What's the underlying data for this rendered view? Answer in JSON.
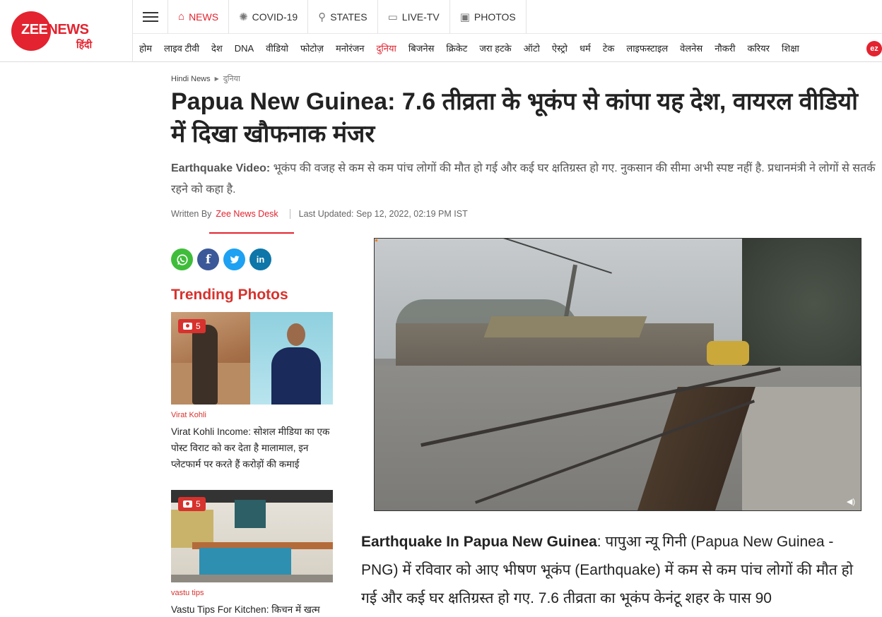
{
  "brand": {
    "logo_main_a": "ZEE",
    "logo_main_b": "NEWS",
    "logo_sub": "हिंदी",
    "accent_color": "#e3232f"
  },
  "topnav": {
    "menu_icon": "hamburger-icon",
    "items": [
      {
        "label": "NEWS",
        "icon": "home-icon",
        "active": true
      },
      {
        "label": "COVID-19",
        "icon": "virus-icon"
      },
      {
        "label": "STATES",
        "icon": "location-pin-icon"
      },
      {
        "label": "LIVE-TV",
        "icon": "tv-icon"
      },
      {
        "label": "PHOTOS",
        "icon": "image-icon"
      }
    ]
  },
  "categories": [
    "होम",
    "लाइव टीवी",
    "देश",
    "DNA",
    "वीडियो",
    "फोटोज़",
    "मनोरंजन",
    "दुनिया",
    "बिजनेस",
    "क्रिकेट",
    "जरा हटके",
    "ऑटो",
    "ऐस्ट्रो",
    "धर्म",
    "टेक",
    "लाइफस्टाइल",
    "वेलनेस",
    "नौकरी",
    "करियर",
    "शिक्षा"
  ],
  "active_category": "दुनिया",
  "breadcrumb": {
    "home": "Hindi News",
    "section": "दुनिया"
  },
  "article": {
    "headline": "Papua New Guinea: 7.6 तीव्रता के भूकंप से कांपा यह देश, वायरल वीडियो में दिखा खौफनाक मंजर",
    "summary_lead": "Earthquake Video:",
    "summary_text": " भूकंप की वजह से  कम से कम पांच लोगों की मौत हो गई और कई घर क्षतिग्रस्त हो गए. नुकसान की सीमा अभी स्पष्ट नहीं है. प्रधानमंत्री ने लोगों से सतर्क रहने को कहा है.",
    "written_by_label": "Written By",
    "author": "Zee News Desk",
    "updated": "Last Updated: Sep 12, 2022, 02:19 PM IST",
    "body_lead": "Earthquake In Papua New Guinea",
    "body_text": ":  पापुआ न्यू गिनी (Papua New Guinea - PNG) में रविवार को आए भीषण भूकंप (Earthquake) में कम से कम पांच लोगों की मौत हो गई और कई घर क्षतिग्रस्त हो गए. 7.6 तीव्रता का भूकंप केनंटू शहर के पास 90"
  },
  "share": {
    "whatsapp": "whatsapp-icon",
    "facebook": "f",
    "twitter": "twitter-icon",
    "linkedin": "in"
  },
  "trending": {
    "title": "Trending Photos",
    "cards": [
      {
        "count": "5",
        "tag": "Virat Kohli",
        "title": "Virat Kohli Income: सोशल मीडिया का एक पोस्ट विराट को कर देता है मालामाल, इन प्लेटफार्म पर करते हैं करोड़ों की कमाई"
      },
      {
        "count": "5",
        "tag": "vastu tips",
        "title": "Vastu Tips For Kitchen: किचन में खत्म"
      }
    ]
  }
}
